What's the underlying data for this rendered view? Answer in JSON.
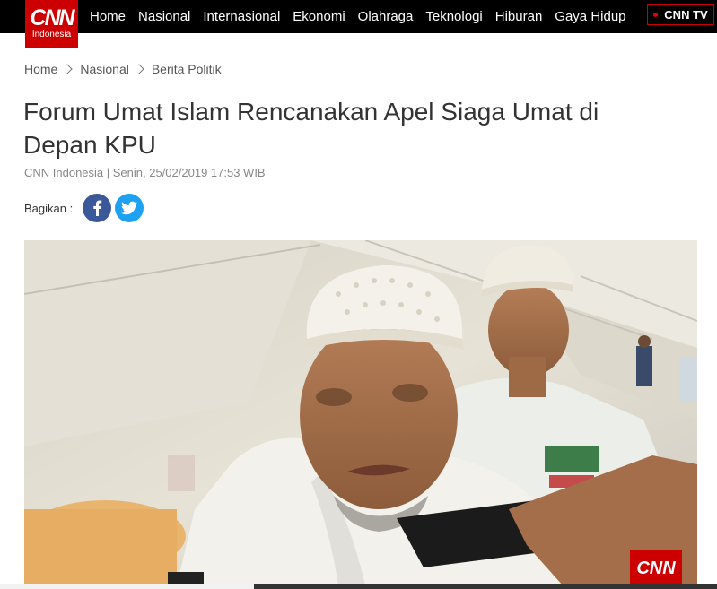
{
  "brand": {
    "logo_text": "CNN",
    "logo_subtext": "Indonesia"
  },
  "nav": {
    "items": [
      "Home",
      "Nasional",
      "Internasional",
      "Ekonomi",
      "Olahraga",
      "Teknologi",
      "Hiburan",
      "Gaya Hidup"
    ],
    "live_tv_label": "CNN TV"
  },
  "breadcrumb": {
    "items": [
      "Home",
      "Nasional",
      "Berita Politik"
    ]
  },
  "article": {
    "title": "Forum Umat Islam Rencanakan Apel Siaga Umat di Depan KPU",
    "meta": "CNN Indonesia | Senin, 25/02/2019 17:53 WIB"
  },
  "share": {
    "label": "Bagikan :",
    "buttons": [
      {
        "name": "facebook",
        "icon": "facebook-icon",
        "color": "#3b5998"
      },
      {
        "name": "twitter",
        "icon": "twitter-icon",
        "color": "#1da1f2"
      }
    ]
  },
  "photo": {
    "watermark": "CNN"
  },
  "colors": {
    "brand_red": "#cc0000",
    "nav_bg": "#000000"
  }
}
